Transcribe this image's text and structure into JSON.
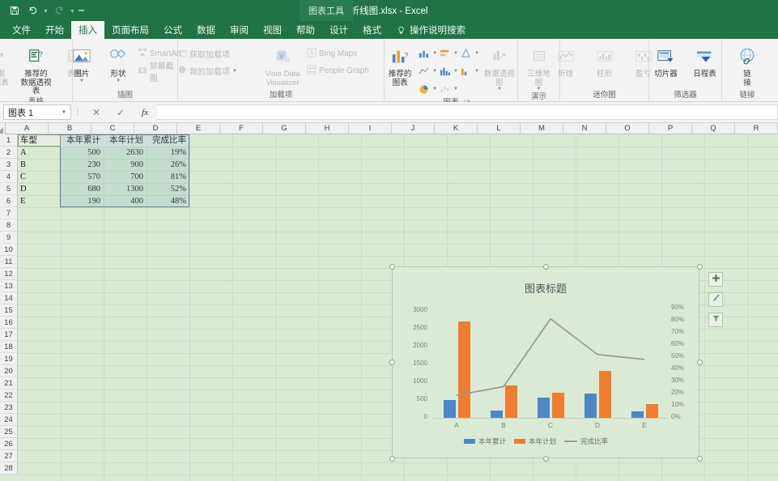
{
  "window": {
    "doc_title": "折线图.xlsx  -  Excel",
    "contextual_tab_title": "图表工具",
    "qat": [
      {
        "name": "save-icon",
        "label": "保存"
      },
      {
        "name": "undo-icon",
        "label": "撤销"
      },
      {
        "name": "redo-icon",
        "label": "恢复"
      },
      {
        "name": "customize-qat-icon",
        "label": "自定义快速访问工具栏"
      }
    ]
  },
  "tabs": [
    {
      "label": "文件",
      "active": false,
      "contextual": false
    },
    {
      "label": "开始",
      "active": false,
      "contextual": false
    },
    {
      "label": "插入",
      "active": true,
      "contextual": false
    },
    {
      "label": "页面布局",
      "active": false,
      "contextual": false
    },
    {
      "label": "公式",
      "active": false,
      "contextual": false
    },
    {
      "label": "数据",
      "active": false,
      "contextual": false
    },
    {
      "label": "审阅",
      "active": false,
      "contextual": false
    },
    {
      "label": "视图",
      "active": false,
      "contextual": false
    },
    {
      "label": "帮助",
      "active": false,
      "contextual": false
    },
    {
      "label": "设计",
      "active": false,
      "contextual": true
    },
    {
      "label": "格式",
      "active": false,
      "contextual": true
    }
  ],
  "tell_me": {
    "label": "操作说明搜索",
    "icon": "lightbulb-icon"
  },
  "ribbon": {
    "groups": [
      {
        "name": "tables",
        "label": "表格",
        "big_buttons": [
          {
            "name": "pivot-table-button",
            "label": "数据\n透视表",
            "icon": "pivot-table-icon",
            "disabled": true,
            "caret": true
          },
          {
            "name": "recommended-pivot-tables-button",
            "label": "推荐的\n数据透视表",
            "icon": "recommended-pivot-icon",
            "disabled": false,
            "caret": false
          },
          {
            "name": "table-button",
            "label": "表格",
            "icon": "table-icon",
            "disabled": true,
            "caret": false
          }
        ]
      },
      {
        "name": "illustrations",
        "label": "插图",
        "big_buttons": [
          {
            "name": "pictures-button",
            "label": "图片",
            "icon": "picture-icon",
            "disabled": false,
            "caret": true
          },
          {
            "name": "shapes-button",
            "label": "形状",
            "icon": "shapes-icon",
            "disabled": false,
            "caret": true
          }
        ],
        "small_buttons": [
          {
            "name": "smartart-button",
            "label": "SmartArt",
            "icon": "smartart-icon",
            "disabled": true
          },
          {
            "name": "screenshot-button",
            "label": "屏幕截图",
            "icon": "screenshot-icon",
            "disabled": true,
            "caret": true
          }
        ]
      },
      {
        "name": "add-ins",
        "label": "加载项",
        "small_buttons": [
          {
            "name": "get-add-ins-button",
            "label": "获取加载项",
            "icon": "store-icon",
            "disabled": true
          },
          {
            "name": "my-add-ins-button",
            "label": "我的加载项",
            "icon": "my-addins-icon",
            "disabled": true,
            "caret": true
          }
        ],
        "big_buttons": [
          {
            "name": "visio-data-visualizer-button",
            "label": "Visio Data\nVisualizer",
            "icon": "visio-icon",
            "disabled": true,
            "caret": false
          }
        ],
        "extra_buttons": [
          {
            "name": "bing-maps-button",
            "label": "Bing Maps",
            "icon": "bing-maps-icon",
            "disabled": true
          },
          {
            "name": "people-graph-button",
            "label": "People Graph",
            "icon": "people-graph-icon",
            "disabled": true
          }
        ]
      },
      {
        "name": "charts",
        "label": "图表",
        "has_dialog_launcher": true,
        "big_buttons": [
          {
            "name": "recommended-charts-button",
            "label": "推荐的\n图表",
            "icon": "recommended-charts-icon",
            "disabled": false,
            "caret": false
          },
          {
            "name": "pivot-chart-button",
            "label": "数据透视图",
            "icon": "pivot-chart-icon",
            "disabled": true,
            "caret": true
          }
        ],
        "chart_type_buttons": [
          {
            "name": "column-chart-button",
            "icon": "column-chart-icon"
          },
          {
            "name": "line-chart-button",
            "icon": "line-chart-icon"
          },
          {
            "name": "pie-chart-button",
            "icon": "pie-chart-icon"
          },
          {
            "name": "bar-chart-button",
            "icon": "bar-chart-icon"
          },
          {
            "name": "area-chart-button",
            "icon": "area-chart-icon"
          },
          {
            "name": "scatter-chart-button",
            "icon": "scatter-chart-icon"
          },
          {
            "name": "hierarchy-chart-button",
            "icon": "hierarchy-chart-icon"
          },
          {
            "name": "statistic-chart-button",
            "icon": "statistic-chart-icon"
          }
        ]
      },
      {
        "name": "tours",
        "label": "演示",
        "big_buttons": [
          {
            "name": "3d-map-button",
            "label": "三维地\n图",
            "icon": "3d-map-icon",
            "disabled": true,
            "caret": true
          }
        ]
      },
      {
        "name": "sparklines",
        "label": "迷你图",
        "big_buttons": [
          {
            "name": "sparkline-line-button",
            "label": "折线",
            "icon": "sparkline-line-icon",
            "disabled": true,
            "caret": false
          },
          {
            "name": "sparkline-column-button",
            "label": "柱形",
            "icon": "sparkline-column-icon",
            "disabled": true,
            "caret": false
          },
          {
            "name": "sparkline-winloss-button",
            "label": "盈亏",
            "icon": "sparkline-winloss-icon",
            "disabled": true,
            "caret": false
          }
        ]
      },
      {
        "name": "filters",
        "label": "筛选器",
        "big_buttons": [
          {
            "name": "slicer-button",
            "label": "切片器",
            "icon": "slicer-icon",
            "disabled": false,
            "caret": false
          },
          {
            "name": "timeline-button",
            "label": "日程表",
            "icon": "timeline-icon",
            "disabled": false,
            "caret": false
          }
        ]
      },
      {
        "name": "links",
        "label": "链接",
        "big_buttons": [
          {
            "name": "link-button",
            "label": "链\n接",
            "icon": "link-icon",
            "disabled": false,
            "caret": false
          }
        ]
      }
    ]
  },
  "formula_bar": {
    "name_box_value": "图表 1",
    "formula_value": "",
    "cancel_icon": "cancel-icon",
    "enter_icon": "confirm-icon",
    "function_icon": "insert-function-icon"
  },
  "sheet": {
    "column_headers": [
      "A",
      "B",
      "C",
      "D",
      "E",
      "F",
      "G",
      "H",
      "I",
      "J",
      "K",
      "L",
      "M",
      "N",
      "O",
      "P",
      "Q",
      "R"
    ],
    "row_headers": [
      1,
      2,
      3,
      4,
      5,
      6,
      7,
      8,
      9,
      10,
      11,
      12,
      13,
      14,
      15,
      16,
      17,
      18,
      19,
      20,
      21,
      22,
      23,
      24,
      25,
      26,
      27,
      28
    ],
    "header_row": [
      "车型",
      "本年累计",
      "本年计划",
      "完成比率"
    ],
    "rows": [
      {
        "model": "A",
        "ytd": "500",
        "plan": "2630",
        "rate": "19%"
      },
      {
        "model": "B",
        "ytd": "230",
        "plan": "900",
        "rate": "26%"
      },
      {
        "model": "C",
        "ytd": "570",
        "plan": "700",
        "rate": "81%"
      },
      {
        "model": "D",
        "ytd": "680",
        "plan": "1300",
        "rate": "52%"
      },
      {
        "model": "E",
        "ytd": "190",
        "plan": "400",
        "rate": "48%"
      }
    ],
    "selected_range": "B1:D6",
    "background_color": "#d9ead3"
  },
  "chart_data": {
    "type": "bar",
    "title": "图表标题",
    "categories": [
      "A",
      "B",
      "C",
      "D",
      "E"
    ],
    "series": [
      {
        "name": "本年累计",
        "type": "bar",
        "color": "#4f86c6",
        "axis": "primary",
        "values": [
          500,
          230,
          570,
          680,
          190
        ]
      },
      {
        "name": "本年计划",
        "type": "bar",
        "color": "#ed7d31",
        "axis": "primary",
        "values": [
          2630,
          900,
          700,
          1300,
          400
        ]
      },
      {
        "name": "完成比率",
        "type": "line",
        "color": "#9a9a9a",
        "axis": "secondary",
        "values": [
          0.19,
          0.26,
          0.81,
          0.52,
          0.48
        ]
      }
    ],
    "primary_axis": {
      "ticks": [
        "0",
        "500",
        "1000",
        "1500",
        "2000",
        "2500",
        "3000"
      ],
      "min": 0,
      "max": 3000
    },
    "secondary_axis": {
      "ticks": [
        "0%",
        "10%",
        "20%",
        "30%",
        "40%",
        "50%",
        "60%",
        "70%",
        "80%",
        "90%"
      ],
      "min": 0,
      "max": 0.9
    },
    "legend_position": "bottom",
    "grid": false,
    "xlabel": "",
    "ylabel": ""
  },
  "chart_side_buttons": [
    {
      "name": "chart-elements-button",
      "icon": "plus-icon",
      "label": "图表元素"
    },
    {
      "name": "chart-styles-button",
      "icon": "brush-icon",
      "label": "图表样式"
    },
    {
      "name": "chart-filters-button",
      "icon": "funnel-icon",
      "label": "图表筛选器"
    }
  ]
}
